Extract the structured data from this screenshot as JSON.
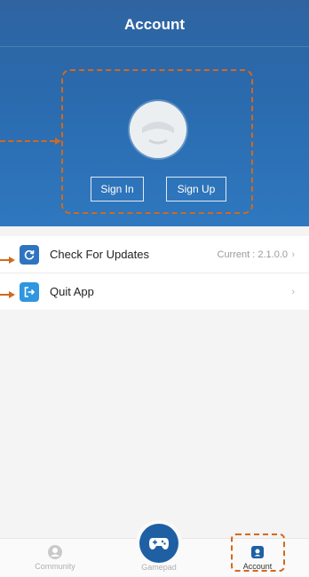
{
  "header": {
    "title": "Account"
  },
  "profile": {
    "sign_in_label": "Sign In",
    "sign_up_label": "Sign Up"
  },
  "menu": [
    {
      "label": "Check For Updates",
      "value": "Current : 2.1.0.0",
      "icon": "refresh-icon",
      "color": "#2f74c0"
    },
    {
      "label": "Quit App",
      "value": "",
      "icon": "exit-icon",
      "color": "#2f96df"
    }
  ],
  "tabbar": {
    "items": [
      {
        "label": "Community",
        "icon": "community-icon"
      },
      {
        "label": "Gamepad",
        "icon": "gamepad-icon"
      },
      {
        "label": "Account",
        "icon": "account-icon"
      }
    ]
  },
  "colors": {
    "header": "#2f6db2",
    "accent": "#1f5fa4",
    "annotation": "#d2691e"
  }
}
